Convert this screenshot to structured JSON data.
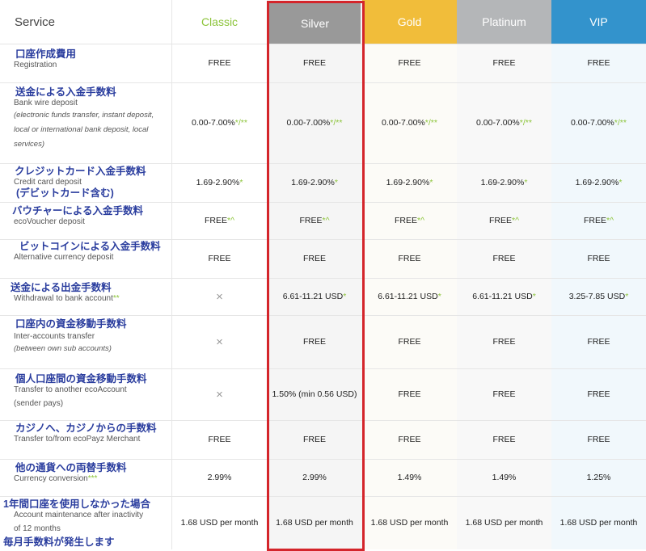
{
  "header": {
    "service": "Service",
    "tiers": [
      {
        "label": "Classic",
        "bg": "#ffffff",
        "color": "#8cc43a"
      },
      {
        "label": "Silver",
        "bg": "#999999",
        "color": "#ffffff"
      },
      {
        "label": "Gold",
        "bg": "#f1bd3a",
        "color": "#ffffff"
      },
      {
        "label": "Platinum",
        "bg": "#b4b6b8",
        "color": "#ffffff"
      },
      {
        "label": "VIP",
        "bg": "#3393cc",
        "color": "#ffffff"
      }
    ]
  },
  "colors": {
    "accent_green": "#8cc43a",
    "highlight_border": "#d4252b",
    "japanese_label": "#2a3d9e"
  },
  "rows": [
    {
      "jp": "口座作成費用",
      "en": "Registration",
      "note": "",
      "cells": [
        "FREE",
        "FREE",
        "FREE",
        "FREE",
        "FREE"
      ]
    },
    {
      "jp": "送金による入金手数料",
      "en": "Bank wire deposit",
      "note": "(electronic funds transfer, instant deposit, local or international bank deposit, local services)",
      "cells": [
        "0.00-7.00%",
        "0.00-7.00%",
        "0.00-7.00%",
        "0.00-7.00%",
        "0.00-7.00%"
      ],
      "suffix": "*/**"
    },
    {
      "jp": "クレジットカード入金手数料",
      "en": "Credit card deposit",
      "jp2": "(デビットカード含む)",
      "note": "",
      "cells": [
        "1.69-2.90%",
        "1.69-2.90%",
        "1.69-2.90%",
        "1.69-2.90%",
        "1.69-2.90%"
      ],
      "suffix": "*"
    },
    {
      "jp": "バウチャーによる入金手数料",
      "en": "ecoVoucher deposit",
      "note": "",
      "cells": [
        "FREE",
        "FREE",
        "FREE",
        "FREE",
        "FREE"
      ],
      "suffix": "*^"
    },
    {
      "jp": "ビットコインによる入金手数料",
      "en": "Alternative currency deposit",
      "note": "",
      "cells": [
        "FREE",
        "FREE",
        "FREE",
        "FREE",
        "FREE"
      ]
    },
    {
      "jp": "送金による出金手数料",
      "en": "Withdrawal to bank account",
      "en_suffix": "**",
      "note": "",
      "cells": [
        "×",
        "6.61-11.21 USD",
        "6.61-11.21 USD",
        "6.61-11.21 USD",
        "3.25-7.85 USD"
      ],
      "suffix": "*"
    },
    {
      "jp": "口座内の資金移動手数料",
      "en": "Inter-accounts transfer",
      "note": "(between own sub accounts)",
      "cells": [
        "×",
        "FREE",
        "FREE",
        "FREE",
        "FREE"
      ]
    },
    {
      "jp": "個人口座間の資金移動手数料",
      "en": "Transfer to another ecoAccount",
      "note": "(sender pays)",
      "cells": [
        "×",
        "1.50% (min 0.56 USD)",
        "FREE",
        "FREE",
        "FREE"
      ]
    },
    {
      "jp": "カジノへ、カジノからの手数料",
      "en": "Transfer to/from ecoPayz Merchant",
      "note": "",
      "cells": [
        "FREE",
        "FREE",
        "FREE",
        "FREE",
        "FREE"
      ]
    },
    {
      "jp": "他の通貨への両替手数料",
      "en": "Currency conversion",
      "en_suffix": "***",
      "note": "",
      "cells": [
        "2.99%",
        "2.99%",
        "1.49%",
        "1.49%",
        "1.25%"
      ]
    },
    {
      "jp": "1年間口座を使用しなかった場合",
      "en": "Account maintenance after inactivity",
      "en2": "of 12 months",
      "jp2": "毎月手数料が発生します",
      "note": "",
      "cells": [
        "1.68 USD per month",
        "1.68 USD per month",
        "1.68 USD per month",
        "1.68 USD per month",
        "1.68 USD per month"
      ]
    }
  ]
}
